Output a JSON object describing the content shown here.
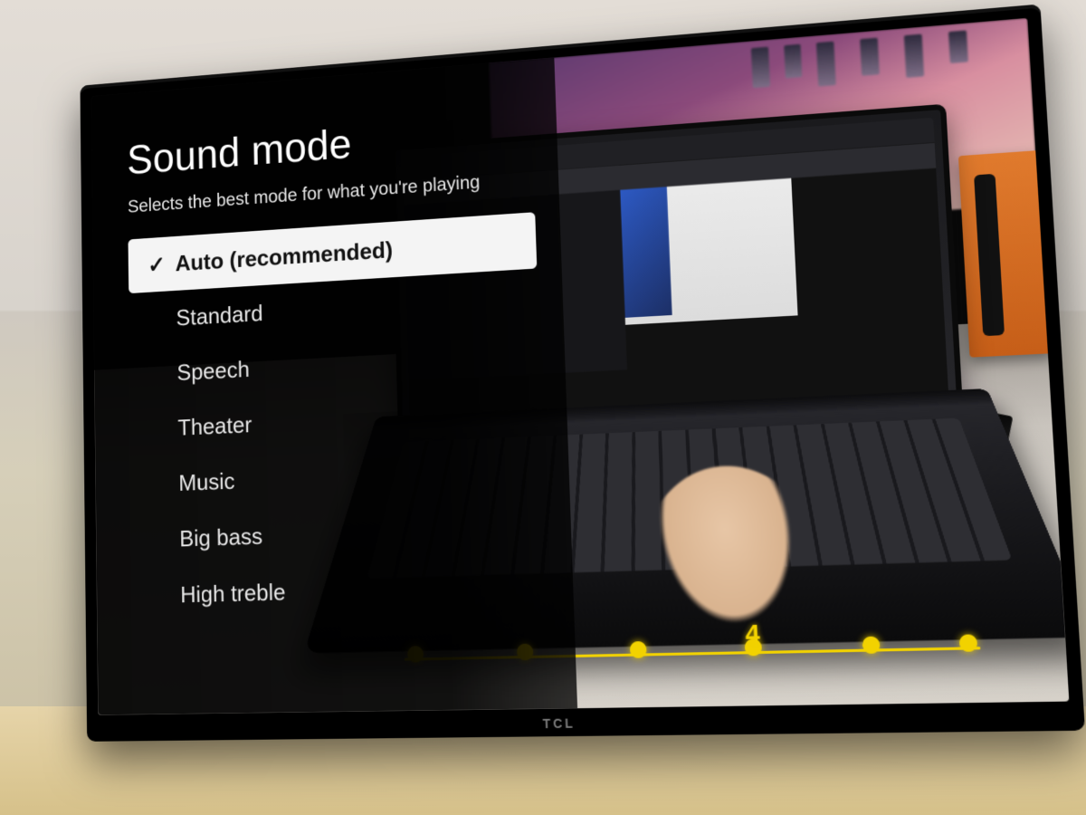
{
  "tv_brand": "TCL",
  "menu": {
    "title": "Sound mode",
    "description": "Selects the best mode for what you're playing",
    "selected_index": 0,
    "options": [
      "Auto (recommended)",
      "Standard",
      "Speech",
      "Theater",
      "Music",
      "Big bass",
      "High treble"
    ]
  },
  "progress": {
    "current_step": 4,
    "total_steps": 6
  }
}
